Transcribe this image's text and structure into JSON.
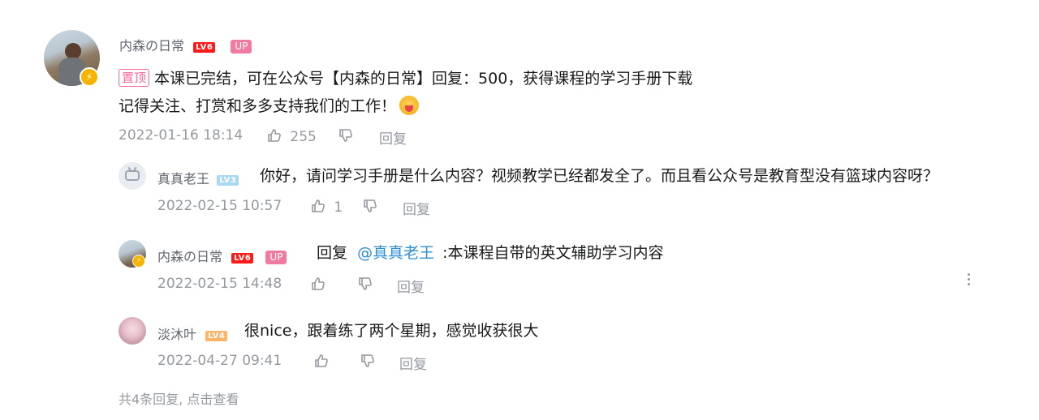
{
  "main_comment": {
    "user": {
      "name": "内森の日常",
      "level": "LV6",
      "up_badge": "UP",
      "avatar": "user-avatar-photo",
      "verified_icon": "lightning-icon"
    },
    "pin_label": "置顶",
    "line1": "本课已完结，可在公众号【内森的日常】回复：500，获得课程的学习手册下载",
    "line2": "记得关注、打赏和多多支持我们的工作！",
    "emoji": "heart-hug-emoji",
    "timestamp": "2022-01-16 18:14",
    "like_count": "255",
    "reply_label": "回复"
  },
  "replies": [
    {
      "user": {
        "name": "真真老王",
        "level": "LV3",
        "avatar": "tv-avatar"
      },
      "text": "你好，请问学习手册是什么内容？视频教学已经都发全了。而且看公众号是教育型没有篮球内容呀？",
      "timestamp": "2022-02-15 10:57",
      "like_count": "1",
      "reply_label": "回复"
    },
    {
      "user": {
        "name": "内森の日常",
        "level": "LV6",
        "up_badge": "UP",
        "avatar": "user-avatar-photo"
      },
      "reply_prefix": "回复",
      "mention": "@真真老王",
      "text": ":本课程自带的英文辅助学习内容",
      "timestamp": "2022-02-15 14:48",
      "reply_label": "回复"
    },
    {
      "user": {
        "name": "淡沐叶",
        "level": "LV4",
        "avatar": "anime-avatar"
      },
      "text": "很nice，跟着练了两个星期，感觉收获很大",
      "timestamp": "2022-04-27 09:41",
      "reply_label": "回复"
    }
  ],
  "footer": {
    "text": "共4条回复, 点击查看"
  },
  "colors": {
    "accent_pink": "#ff6699",
    "lv6": "#ff1a1a",
    "lv3": "#a7d9f5",
    "lv4": "#ffb36b",
    "mention": "#2c8fd6",
    "meta_gray": "#9499a0"
  }
}
